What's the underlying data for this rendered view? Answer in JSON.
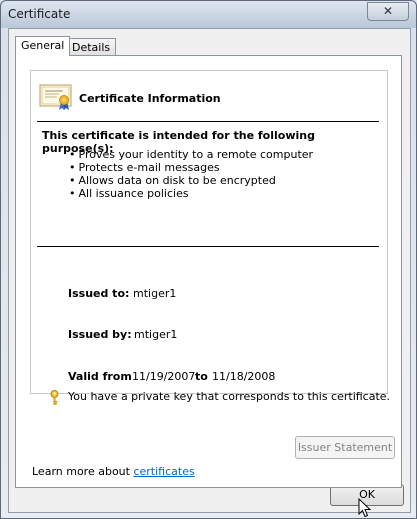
{
  "window": {
    "title": "Certificate",
    "close_glyph": "✕"
  },
  "tabs": [
    {
      "label": "General",
      "selected": true
    },
    {
      "label": "Details",
      "selected": false
    }
  ],
  "info": {
    "title": "Certificate Information",
    "purpose_heading": "This certificate is intended for the following purpose(s):",
    "purposes": [
      "Proves your identity to a remote computer",
      "Protects e-mail messages",
      "Allows data on disk to be encrypted",
      "All issuance policies"
    ]
  },
  "fields": {
    "issued_to_label": "Issued to:",
    "issued_to_value": "mtiger1",
    "issued_by_label": "Issued by:",
    "issued_by_value": "mtiger1",
    "valid_from_label": "Valid from",
    "valid_from_value": "11/19/2007",
    "to_label": "to",
    "valid_to_value": "11/18/2008"
  },
  "private_key_text": "You have a private key that corresponds to this certificate.",
  "buttons": {
    "issuer_statement": "Issuer Statement",
    "ok": "OK"
  },
  "learn_more": {
    "prefix": "Learn more about ",
    "link": "certificates"
  },
  "icons": {
    "certificate": "certificate-icon",
    "key": "key-icon",
    "close": "close-icon"
  },
  "colors": {
    "link": "#0066cc",
    "disabled_text": "#838383"
  }
}
